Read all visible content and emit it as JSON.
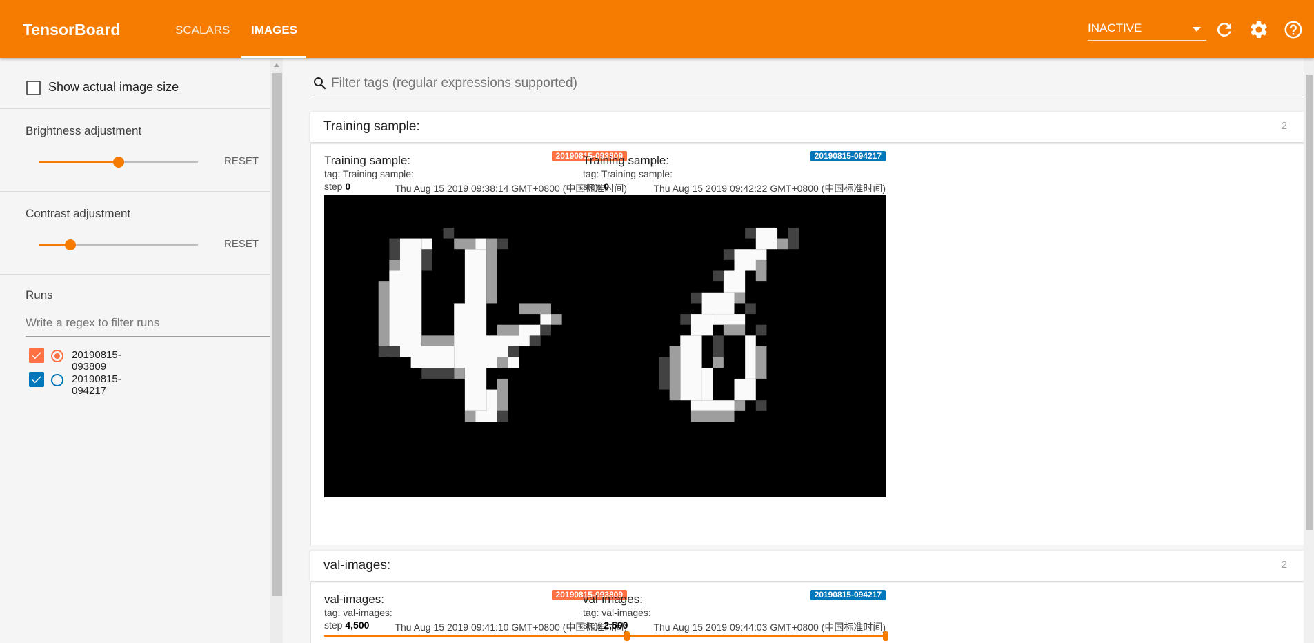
{
  "app": {
    "title": "TensorBoard"
  },
  "nav": {
    "tabs": [
      {
        "label": "SCALARS"
      },
      {
        "label": "IMAGES"
      }
    ]
  },
  "header": {
    "run_status": "INACTIVE",
    "icons": [
      "refresh-icon",
      "settings-icon",
      "help-icon"
    ]
  },
  "sidebar": {
    "show_actual_size_label": "Show actual image size",
    "brightness": {
      "title": "Brightness adjustment",
      "reset_label": "RESET",
      "value": 0.5
    },
    "contrast": {
      "title": "Contrast adjustment",
      "reset_label": "RESET",
      "value": 0.2
    },
    "runs": {
      "title": "Runs",
      "filter_placeholder": "Write a regex to filter runs",
      "items": [
        {
          "name": "20190815-093809",
          "color": "#ff7043",
          "checked": true,
          "selected": true
        },
        {
          "name": "20190815-094217",
          "color": "#0077bb",
          "checked": true,
          "selected": false
        }
      ]
    }
  },
  "main": {
    "filter_placeholder": "Filter tags (regular expressions supported)",
    "cards": [
      {
        "title": "Training sample:",
        "count": "2",
        "panels": [
          {
            "title": "Training sample:",
            "tag": "tag: Training sample:",
            "step_label": "step",
            "step": "0",
            "time": "Thu Aug 15 2019 09:38:14 GMT+0800 (中国标准时间)",
            "run": "20190815-093809",
            "run_color": "#ff7043",
            "digit": "4"
          },
          {
            "title": "Training sample:",
            "tag": "tag: Training sample:",
            "step_label": "step",
            "step": "0",
            "time": "Thu Aug 15 2019 09:42:22 GMT+0800 (中国标准时间)",
            "run": "20190815-094217",
            "run_color": "#0077bb",
            "digit": "6"
          }
        ]
      },
      {
        "title": "val-images:",
        "count": "2",
        "panels": [
          {
            "title": "val-images:",
            "tag": "tag: val-images:",
            "step_label": "step",
            "step": "4,500",
            "time": "Thu Aug 15 2019 09:41:10 GMT+0800 (中国标准时间)",
            "run": "20190815-093809",
            "run_color": "#ff7043"
          },
          {
            "title": "val-images:",
            "tag": "tag: val-images:",
            "step_label": "step",
            "step": "2,500",
            "time": "Thu Aug 15 2019 09:44:03 GMT+0800 (中国标准时间)",
            "run": "20190815-094217",
            "run_color": "#0077bb"
          }
        ]
      }
    ]
  }
}
